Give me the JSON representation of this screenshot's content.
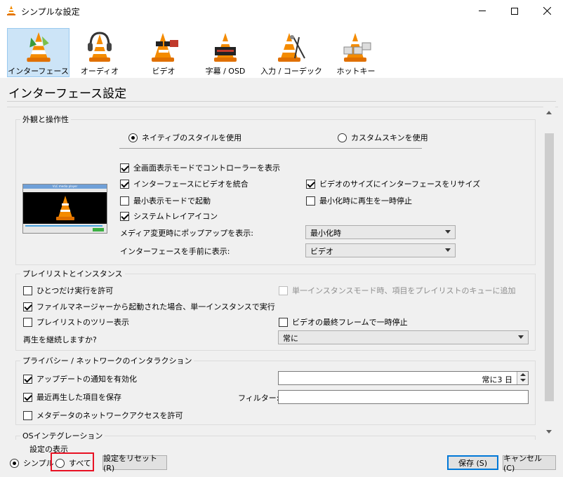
{
  "window": {
    "title": "シンプルな設定",
    "minimize_symbol": "—",
    "maximize_symbol": "☐",
    "close_symbol": "✕"
  },
  "toolbar": {
    "items": [
      {
        "label": "インターフェース",
        "icon": "vlc-cone-interface-icon",
        "selected": true
      },
      {
        "label": "オーディオ",
        "icon": "vlc-cone-headphones-icon",
        "selected": false
      },
      {
        "label": "ビデオ",
        "icon": "vlc-cone-glasses-icon",
        "selected": false
      },
      {
        "label": "字幕 / OSD",
        "icon": "vlc-cone-subtitle-icon",
        "selected": false
      },
      {
        "label": "入力 / コーデック",
        "icon": "vlc-cone-input-icon",
        "selected": false
      },
      {
        "label": "ホットキー",
        "icon": "vlc-cone-hotkey-icon",
        "selected": false
      }
    ]
  },
  "page_title": "インターフェース設定",
  "appearance": {
    "group_title": "外観と操作性",
    "native_style": "ネイティブのスタイルを使用",
    "custom_skin": "カスタムスキンを使用",
    "fs_controller": "全画面表示モードでコントローラーを表示",
    "integrate_video": "インターフェースにビデオを統合",
    "resize_interface": "ビデオのサイズにインターフェースをリサイズ",
    "start_minimal": "最小表示モードで起動",
    "pause_minimized": "最小化時に再生を一時停止",
    "systray": "システムトレイアイコン",
    "popup_label": "メディア変更時にポップアップを表示:",
    "popup_value": "最小化時",
    "raise_label": "インターフェースを手前に表示:",
    "raise_value": "ビデオ",
    "preview_title": "VLC media player"
  },
  "playlist": {
    "group_title": "プレイリストとインスタンス",
    "one_instance": "ひとつだけ実行を許可",
    "enqueue": "単一インスタンスモード時、項目をプレイリストのキューに追加",
    "file_manager": "ファイルマネージャーから起動された場合、単一インスタンスで実行",
    "tree": "プレイリストのツリー表示",
    "pause_last": "ビデオの最終フレームで一時停止",
    "continue_label": "再生を継続しますか?",
    "continue_value": "常に"
  },
  "privacy": {
    "group_title": "プライバシー / ネットワークのインタラクション",
    "update_notify": "アップデートの通知を有効化",
    "update_value": "常に3 日",
    "save_recent": "最近再生した項目を保存",
    "filter_label": "フィルター:",
    "filter_value": "",
    "metadata": "メタデータのネットワークアクセスを許可"
  },
  "os_integration": {
    "group_title": "OSインテグレーション"
  },
  "footer": {
    "show_settings": "設定の表示",
    "simple": "シンプル",
    "all": "すべて",
    "reset": "設定をリセット (R)",
    "save": "保存 (S)",
    "cancel": "キャンセル (C)"
  },
  "colors": {
    "selected_tab_bg": "#cce4f7",
    "highlight_red": "#e81123",
    "accent_blue": "#0078d7",
    "vlc_orange": "#f48b00"
  }
}
